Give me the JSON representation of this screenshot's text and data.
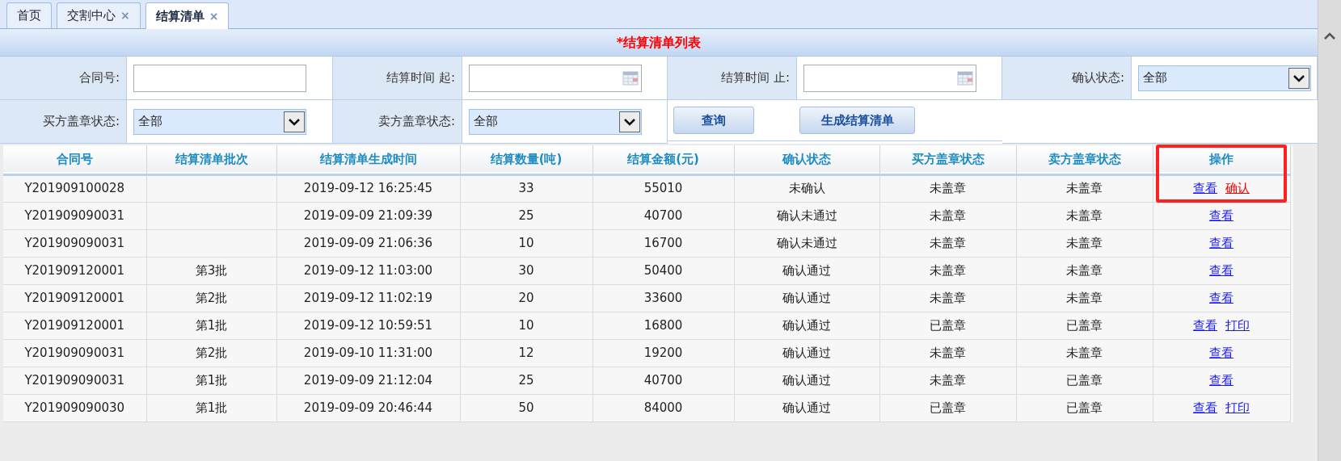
{
  "tabs": [
    {
      "label": "首页",
      "closable": false,
      "selected": false
    },
    {
      "label": "交割中心",
      "closable": true,
      "selected": false
    },
    {
      "label": "结算清单",
      "closable": true,
      "selected": true
    }
  ],
  "close_glyph": "×",
  "panel_title": "*结算清单列表",
  "filters": [
    {
      "label": "合同号:",
      "kind": "text"
    },
    {
      "label": "结算时间 起:",
      "kind": "date"
    },
    {
      "label": "结算时间 止:",
      "kind": "date"
    },
    {
      "label": "确认状态:",
      "kind": "select",
      "value": "全部"
    },
    {
      "label": "买方盖章状态:",
      "kind": "select",
      "value": "全部"
    },
    {
      "label": "卖方盖章状态:",
      "kind": "select",
      "value": "全部"
    }
  ],
  "buttons": [
    "查询",
    "生成结算清单"
  ],
  "table": {
    "columns": [
      {
        "label": "合同号"
      },
      {
        "label": "结算清单批次"
      },
      {
        "label": "结算清单生成时间"
      },
      {
        "label": "结算数量(吨)"
      },
      {
        "label": "结算金额(元)"
      },
      {
        "label": "确认状态"
      },
      {
        "label": "买方盖章状态"
      },
      {
        "label": "卖方盖章状态"
      },
      {
        "label": "操作",
        "highlighted": true
      }
    ],
    "rows": [
      {
        "cells": [
          "Y201909100028",
          "",
          "2019-09-12 16:25:45",
          "33",
          "55010",
          "未确认",
          "未盖章",
          "未盖章"
        ],
        "actions": [
          {
            "label": "查看",
            "kind": "normal"
          },
          {
            "label": "确认",
            "kind": "danger"
          }
        ]
      },
      {
        "cells": [
          "Y201909090031",
          "",
          "2019-09-09 21:09:39",
          "25",
          "40700",
          "确认未通过",
          "未盖章",
          "未盖章"
        ],
        "actions": [
          {
            "label": "查看",
            "kind": "normal"
          }
        ]
      },
      {
        "cells": [
          "Y201909090031",
          "",
          "2019-09-09 21:06:36",
          "10",
          "16700",
          "确认未通过",
          "未盖章",
          "未盖章"
        ],
        "actions": [
          {
            "label": "查看",
            "kind": "normal"
          }
        ]
      },
      {
        "cells": [
          "Y201909120001",
          "第3批",
          "2019-09-12 11:03:00",
          "30",
          "50400",
          "确认通过",
          "未盖章",
          "未盖章"
        ],
        "actions": [
          {
            "label": "查看",
            "kind": "normal"
          }
        ]
      },
      {
        "cells": [
          "Y201909120001",
          "第2批",
          "2019-09-12 11:02:19",
          "20",
          "33600",
          "确认通过",
          "未盖章",
          "未盖章"
        ],
        "actions": [
          {
            "label": "查看",
            "kind": "normal"
          }
        ]
      },
      {
        "cells": [
          "Y201909120001",
          "第1批",
          "2019-09-12 10:59:51",
          "10",
          "16800",
          "确认通过",
          "已盖章",
          "已盖章"
        ],
        "actions": [
          {
            "label": "查看",
            "kind": "normal"
          },
          {
            "label": "打印",
            "kind": "normal"
          }
        ]
      },
      {
        "cells": [
          "Y201909090031",
          "第2批",
          "2019-09-10 11:31:00",
          "12",
          "19200",
          "确认通过",
          "未盖章",
          "未盖章"
        ],
        "actions": [
          {
            "label": "查看",
            "kind": "normal"
          }
        ]
      },
      {
        "cells": [
          "Y201909090031",
          "第1批",
          "2019-09-09 21:12:04",
          "25",
          "40700",
          "确认通过",
          "未盖章",
          "已盖章"
        ],
        "actions": [
          {
            "label": "查看",
            "kind": "normal"
          }
        ]
      },
      {
        "cells": [
          "Y201909090030",
          "第1批",
          "2019-09-09 20:46:44",
          "50",
          "84000",
          "确认通过",
          "已盖章",
          "已盖章"
        ],
        "actions": [
          {
            "label": "查看",
            "kind": "normal"
          },
          {
            "label": "打印",
            "kind": "normal"
          }
        ]
      }
    ]
  }
}
